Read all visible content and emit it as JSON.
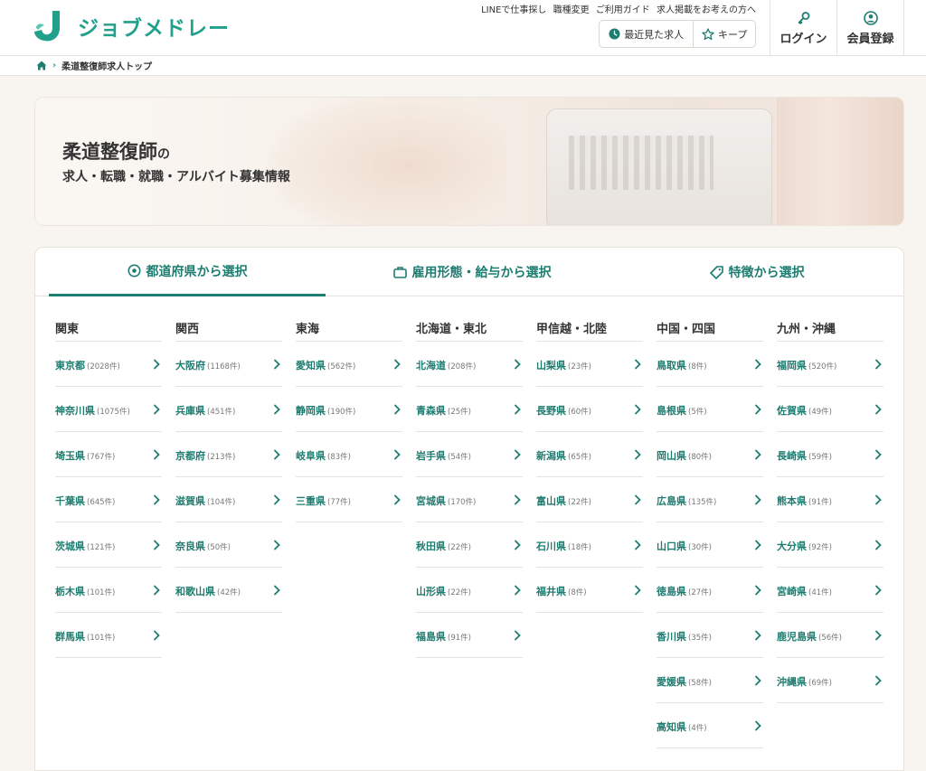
{
  "header": {
    "logo_text": "ジョブメドレー",
    "top_links": [
      "LINEで仕事探し",
      "職種変更",
      "ご利用ガイド",
      "求人掲載をお考えの方へ"
    ],
    "recent_label": "最近見た求人",
    "keep_label": "キープ",
    "login_label": "ログイン",
    "register_label": "会員登録",
    "accent_color": "#21a08c"
  },
  "breadcrumb": {
    "home_icon": "home-icon",
    "current": "柔道整復師求人トップ"
  },
  "hero": {
    "title_main": "柔道整復師",
    "title_suffix": "の",
    "subtitle": "求人・転職・就職・アルバイト募集情報"
  },
  "tabs": [
    {
      "label": "都道府県から選択",
      "icon": "location-pin-icon"
    },
    {
      "label": "雇用形態・給与から選択",
      "icon": "briefcase-icon"
    },
    {
      "label": "特徴から選択",
      "icon": "tag-icon"
    }
  ],
  "regions": [
    {
      "name": "関東",
      "prefs": [
        {
          "name": "東京都",
          "count": "(2028件)"
        },
        {
          "name": "神奈川県",
          "count": "(1075件)"
        },
        {
          "name": "埼玉県",
          "count": "(767件)"
        },
        {
          "name": "千葉県",
          "count": "(645件)"
        },
        {
          "name": "茨城県",
          "count": "(121件)"
        },
        {
          "name": "栃木県",
          "count": "(101件)"
        },
        {
          "name": "群馬県",
          "count": "(101件)"
        }
      ]
    },
    {
      "name": "関西",
      "prefs": [
        {
          "name": "大阪府",
          "count": "(1168件)"
        },
        {
          "name": "兵庫県",
          "count": "(451件)"
        },
        {
          "name": "京都府",
          "count": "(213件)"
        },
        {
          "name": "滋賀県",
          "count": "(104件)"
        },
        {
          "name": "奈良県",
          "count": "(50件)"
        },
        {
          "name": "和歌山県",
          "count": "(42件)"
        }
      ]
    },
    {
      "name": "東海",
      "prefs": [
        {
          "name": "愛知県",
          "count": "(562件)"
        },
        {
          "name": "静岡県",
          "count": "(190件)"
        },
        {
          "name": "岐阜県",
          "count": "(83件)"
        },
        {
          "name": "三重県",
          "count": "(77件)"
        }
      ]
    },
    {
      "name": "北海道・東北",
      "prefs": [
        {
          "name": "北海道",
          "count": "(208件)"
        },
        {
          "name": "青森県",
          "count": "(25件)"
        },
        {
          "name": "岩手県",
          "count": "(54件)"
        },
        {
          "name": "宮城県",
          "count": "(170件)"
        },
        {
          "name": "秋田県",
          "count": "(22件)"
        },
        {
          "name": "山形県",
          "count": "(22件)"
        },
        {
          "name": "福島県",
          "count": "(91件)"
        }
      ]
    },
    {
      "name": "甲信越・北陸",
      "prefs": [
        {
          "name": "山梨県",
          "count": "(23件)"
        },
        {
          "name": "長野県",
          "count": "(60件)"
        },
        {
          "name": "新潟県",
          "count": "(65件)"
        },
        {
          "name": "富山県",
          "count": "(22件)"
        },
        {
          "name": "石川県",
          "count": "(18件)"
        },
        {
          "name": "福井県",
          "count": "(8件)"
        }
      ]
    },
    {
      "name": "中国・四国",
      "prefs": [
        {
          "name": "鳥取県",
          "count": "(8件)"
        },
        {
          "name": "島根県",
          "count": "(5件)"
        },
        {
          "name": "岡山県",
          "count": "(80件)"
        },
        {
          "name": "広島県",
          "count": "(135件)"
        },
        {
          "name": "山口県",
          "count": "(30件)"
        },
        {
          "name": "徳島県",
          "count": "(27件)"
        },
        {
          "name": "香川県",
          "count": "(35件)"
        },
        {
          "name": "愛媛県",
          "count": "(58件)"
        },
        {
          "name": "高知県",
          "count": "(4件)"
        }
      ]
    },
    {
      "name": "九州・沖縄",
      "prefs": [
        {
          "name": "福岡県",
          "count": "(520件)"
        },
        {
          "name": "佐賀県",
          "count": "(49件)"
        },
        {
          "name": "長崎県",
          "count": "(59件)"
        },
        {
          "name": "熊本県",
          "count": "(91件)"
        },
        {
          "name": "大分県",
          "count": "(92件)"
        },
        {
          "name": "宮崎県",
          "count": "(41件)"
        },
        {
          "name": "鹿児島県",
          "count": "(56件)"
        },
        {
          "name": "沖縄県",
          "count": "(69件)"
        }
      ]
    }
  ]
}
